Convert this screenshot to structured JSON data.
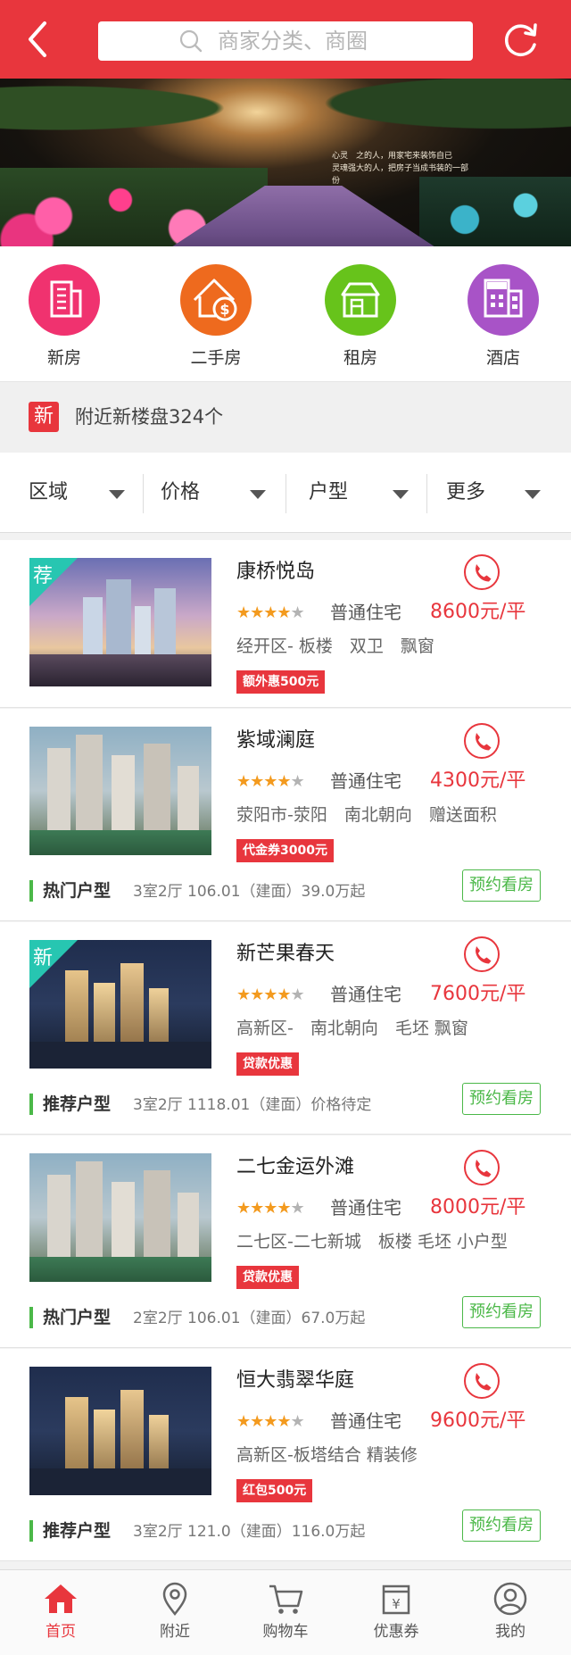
{
  "header": {
    "search_placeholder": "商家分类、商圈"
  },
  "banner": {
    "caption_line1": "心灵　之的人，用家宅来装饰自已",
    "caption_line2": "灵魂强大的人，把房子当成书装的一部份"
  },
  "categories": [
    {
      "label": "新房",
      "color": "#f0326f",
      "icon": "building-icon"
    },
    {
      "label": "二手房",
      "color": "#ee6a1e",
      "icon": "house-dollar-icon"
    },
    {
      "label": "租房",
      "color": "#67c31b",
      "icon": "rent-house-icon"
    },
    {
      "label": "酒店",
      "color": "#a853c7",
      "icon": "hotel-icon"
    }
  ],
  "notice": {
    "badge": "新",
    "text": "附近新楼盘324个"
  },
  "filters": [
    {
      "label": "区域"
    },
    {
      "label": "价格"
    },
    {
      "label": "户型"
    },
    {
      "label": "更多"
    }
  ],
  "listings": [
    {
      "name": "康桥悦岛",
      "rating": 4,
      "type": "普通住宅",
      "price": "8600元/平",
      "tags": "经开区- 板楼　双卫　飘窗",
      "promo": "额外惠500元",
      "corner": "荐"
    },
    {
      "name": "紫域澜庭",
      "rating": 4,
      "type": "普通住宅",
      "price": "4300元/平",
      "tags": "荥阳市-荥阳　南北朝向　赠送面积",
      "promo": "代金券3000元",
      "layout_title": "热门户型",
      "layout_desc": "3室2厅 106.01（建面）39.0万起",
      "book": "预约看房"
    },
    {
      "name": "新芒果春天",
      "rating": 4,
      "type": "普通住宅",
      "price": "7600元/平",
      "tags": "高新区-　南北朝向　毛坯 飘窗",
      "promo": "贷款优惠",
      "corner": "新",
      "layout_title": "推荐户型",
      "layout_desc": "3室2厅 1118.01（建面）价格待定",
      "book": "预约看房"
    },
    {
      "name": "二七金运外滩",
      "rating": 4,
      "type": "普通住宅",
      "price": "8000元/平",
      "tags": "二七区-二七新城　板楼 毛坯 小户型",
      "promo": "贷款优惠",
      "layout_title": "热门户型",
      "layout_desc": "2室2厅 106.01（建面）67.0万起",
      "book": "预约看房"
    },
    {
      "name": "恒大翡翠华庭",
      "rating": 4,
      "type": "普通住宅",
      "price": "9600元/平",
      "tags": "高新区-板塔结合 精装修",
      "promo": "红包500元",
      "layout_title": "推荐户型",
      "layout_desc": "3室2厅 121.0（建面）116.0万起",
      "book": "预约看房"
    }
  ],
  "tabbar": [
    {
      "label": "首页",
      "icon": "home-icon",
      "active": true
    },
    {
      "label": "附近",
      "icon": "location-pin-icon"
    },
    {
      "label": "购物车",
      "icon": "cart-icon"
    },
    {
      "label": "优惠券",
      "icon": "coupon-icon"
    },
    {
      "label": "我的",
      "icon": "user-icon"
    }
  ],
  "colors": {
    "brand_red": "#e8363d",
    "green": "#4bb848",
    "star": "#f39a1e",
    "corner_teal": "#27c6b1"
  }
}
